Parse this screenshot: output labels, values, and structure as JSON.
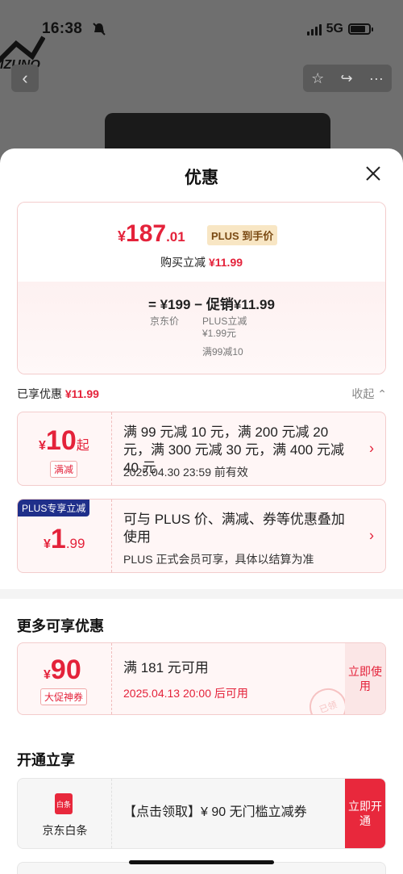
{
  "status": {
    "time": "16:38",
    "network": "5G"
  },
  "background": {
    "brand_text": "IZUNO"
  },
  "sheet": {
    "title": "优惠"
  },
  "price_card": {
    "symbol": "¥",
    "price_int": "187",
    "price_dec": ".01",
    "plus_tag": "PLUS 到手价",
    "discount_label": "购买立减",
    "discount_value": "¥11.99",
    "formula": "= ¥199 − 促销¥11.99",
    "jd_price_label": "京东价",
    "promo_line1": "PLUS立减",
    "promo_line2": "¥1.99元",
    "promo_line3": "满99减10"
  },
  "enjoyed": {
    "label": "已享优惠",
    "value": "¥11.99",
    "collapse": "收起"
  },
  "coupons": [
    {
      "symbol": "¥",
      "amount": "10",
      "suffix": "起",
      "badge": "满减",
      "text": "满 99 元减 10 元，满 200 元减 20 元，满 300 元减 30 元，满 400 元减 40 元",
      "sub": "2025.04.30 23:59 前有效"
    },
    {
      "ribbon": "PLUS专享立减",
      "symbol": "¥",
      "amount": "1",
      "decimal": ".99",
      "text": "可与 PLUS 价、满减、券等优惠叠加使用",
      "sub": "PLUS 正式会员可享，具体以结算为准"
    }
  ],
  "more": {
    "title": "更多可享优惠",
    "symbol": "¥",
    "amount": "90",
    "badge": "大促神券",
    "text": "满 181 元可用",
    "sub": "2025.04.13 20:00 后可用",
    "cta": "立即使用",
    "stamp": "已领"
  },
  "open": {
    "title": "开通立享",
    "icon_text": "白条",
    "label": "京东白条",
    "text": "【点击领取】¥ 90 无门槛立减券",
    "cta": "立即开通"
  }
}
